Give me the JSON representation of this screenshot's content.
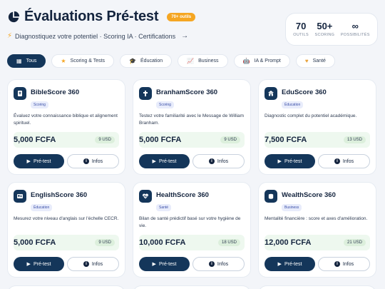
{
  "header": {
    "title": "Évaluations Pré-test",
    "tools_badge": "70+ outils",
    "tagline": "Diagnostiquez votre potentiel · Scoring IA · Certifications",
    "stats": [
      {
        "value": "70",
        "label": "OUTILS"
      },
      {
        "value": "50+",
        "label": "SCORING"
      },
      {
        "value": "∞",
        "label": "POSSIBILITÉS"
      }
    ]
  },
  "filters": [
    {
      "label": "Tous",
      "icon": "grid-icon",
      "active": true
    },
    {
      "label": "Scoring & Tests",
      "icon": "star-icon",
      "active": false
    },
    {
      "label": "Éducation",
      "icon": "graduation-cap-icon",
      "active": false
    },
    {
      "label": "Business",
      "icon": "chart-icon",
      "active": false
    },
    {
      "label": "IA & Prompt",
      "icon": "robot-icon",
      "active": false
    },
    {
      "label": "Santé",
      "icon": "heart-icon",
      "active": false
    }
  ],
  "cards": [
    {
      "name": "BibleScore 360",
      "tag": "Scoring",
      "desc": "Évaluez votre connaissance biblique et alignement spirituel.",
      "price": "5,000 FCFA",
      "usd": "9 USD",
      "icon": "bible-icon"
    },
    {
      "name": "BranhamScore 360",
      "tag": "Scoring",
      "desc": "Testez votre familiarité avec le Message de William Branham.",
      "price": "5,000 FCFA",
      "usd": "9 USD",
      "icon": "cross-icon"
    },
    {
      "name": "EduScore 360",
      "tag": "Éducation",
      "desc": "Diagnostic complet du potentiel académique.",
      "price": "7,500 FCFA",
      "usd": "13 USD",
      "icon": "school-icon"
    },
    {
      "name": "EnglishScore 360",
      "tag": "Éducation",
      "desc": "Mesurez votre niveau d'anglais sur l'échelle CECR.",
      "price": "5,000 FCFA",
      "usd": "9 USD",
      "icon": "language-card-icon"
    },
    {
      "name": "HealthScore 360",
      "tag": "Santé",
      "desc": "Bilan de santé prédictif basé sur votre hygiène de vie.",
      "price": "10,000 FCFA",
      "usd": "18 USD",
      "icon": "heartbeat-icon"
    },
    {
      "name": "WealthScore 360",
      "tag": "Business",
      "desc": "Mentalité financière : score et axes d'amélioration.",
      "price": "12,000 FCFA",
      "usd": "21 USD",
      "icon": "coins-icon"
    }
  ],
  "buttons": {
    "primary": "Pré-test",
    "secondary": "Infos"
  },
  "colors": {
    "navy": "#14365a",
    "accent": "#f5a623",
    "price_bg": "#eef8ef",
    "page_bg": "#f3f5f9"
  }
}
